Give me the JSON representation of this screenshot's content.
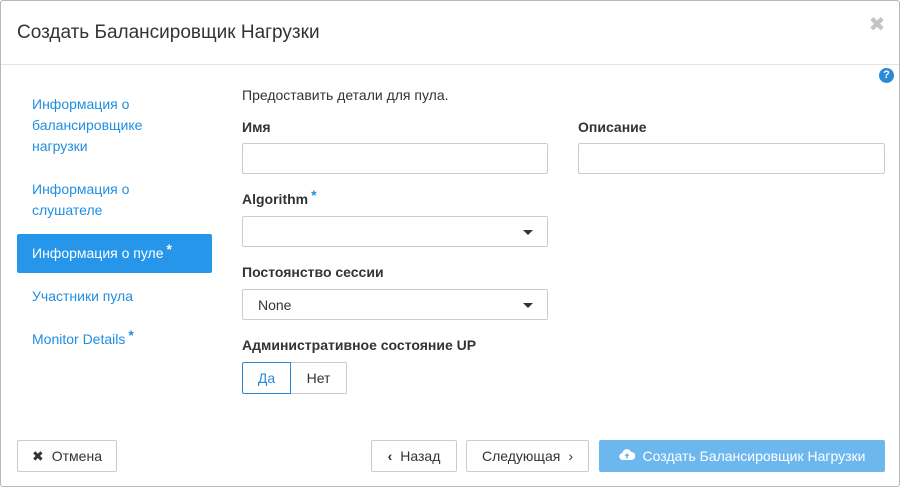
{
  "header": {
    "title": "Создать Балансировщик Нагрузки",
    "close_icon": "✖"
  },
  "help_icon": "?",
  "nav": {
    "items": [
      {
        "label": "Информация о балансировщике нагрузки",
        "required": ""
      },
      {
        "label": "Информация о слушателе",
        "required": ""
      },
      {
        "label": "Информация о пуле",
        "required": "*"
      },
      {
        "label": "Участники пула",
        "required": ""
      },
      {
        "label": "Monitor Details",
        "required": "*"
      }
    ],
    "item0_lines": [
      "Информация о",
      "балансировщике",
      "нагрузки"
    ],
    "item1_lines": [
      "Информация о",
      "слушателе"
    ]
  },
  "form": {
    "intro": "Предоставить детали для пула.",
    "name_label": "Имя",
    "name_value": "",
    "description_label": "Описание",
    "description_value": "",
    "algorithm_label": "Algorithm",
    "algorithm_required": "*",
    "algorithm_value": "",
    "session_label": "Постоянство сессии",
    "session_value": "None",
    "admin_label": "Административное состояние UP",
    "admin_yes": "Да",
    "admin_no": "Нет",
    "admin_selected": "Да"
  },
  "footer": {
    "cancel_label": "Отмена",
    "back_label": "Назад",
    "next_label": "Следующая",
    "create_label": "Создать Балансировщик Нагрузки"
  },
  "colors": {
    "accent": "#2696ea",
    "link": "#1f8fe0",
    "primary_disabled": "#6db7ef"
  }
}
